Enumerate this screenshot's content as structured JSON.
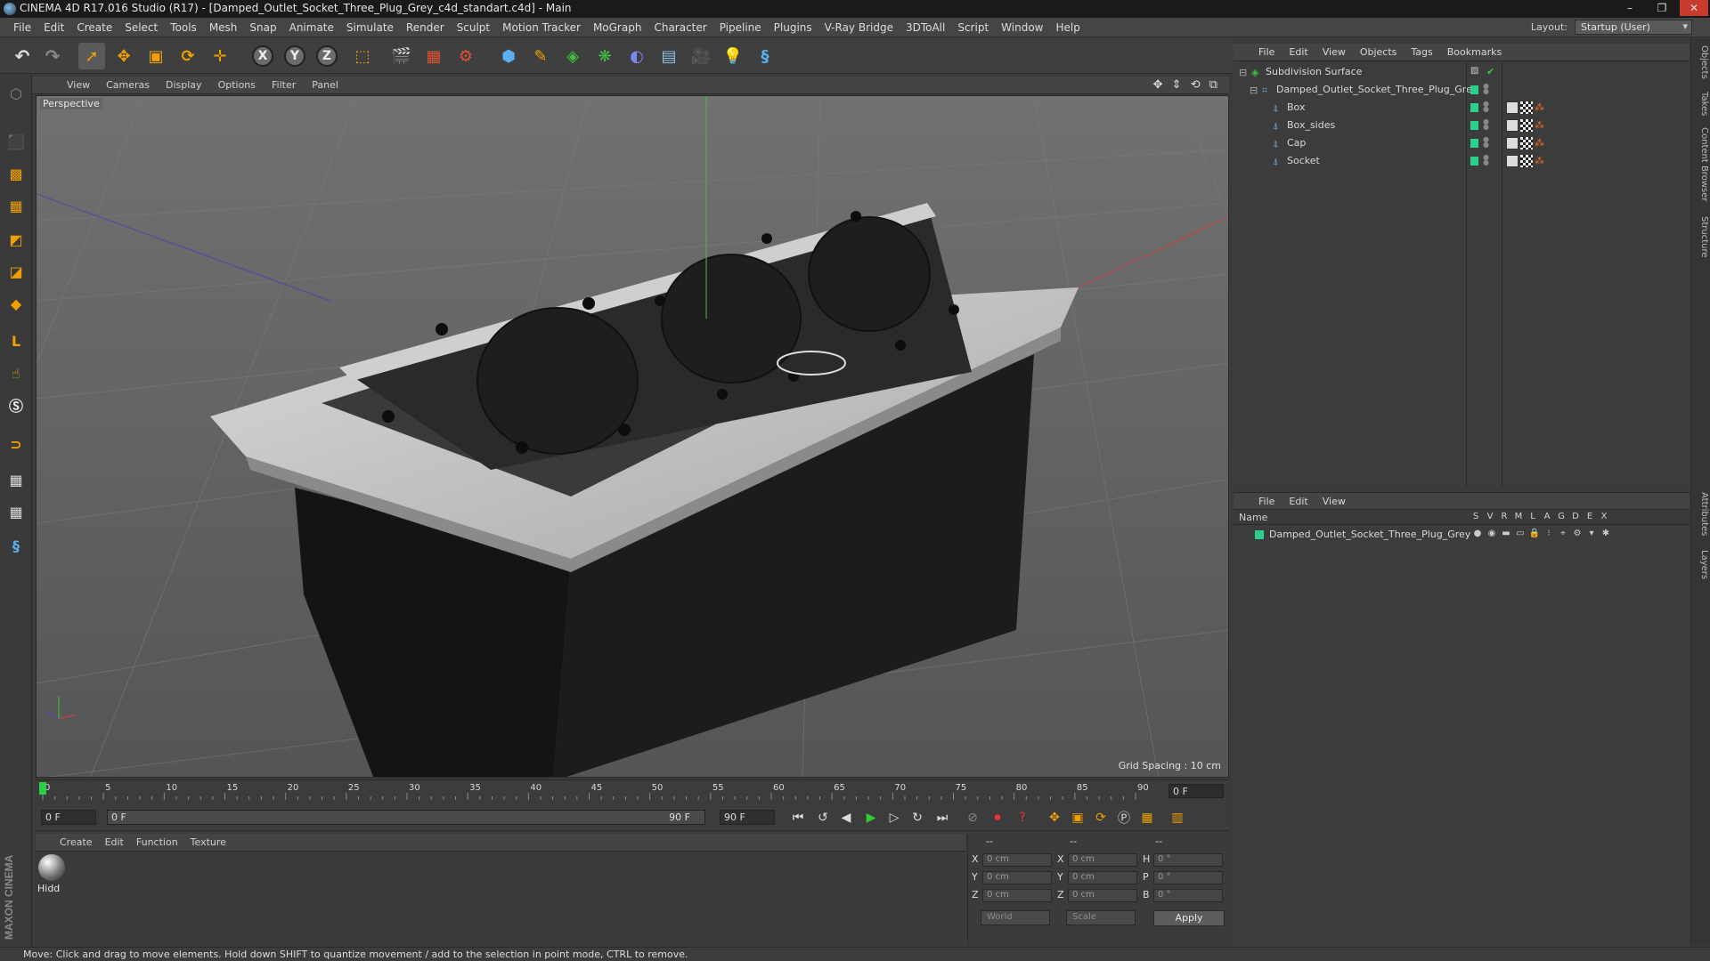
{
  "window": {
    "title": "CINEMA 4D R17.016 Studio (R17) - [Damped_Outlet_Socket_Three_Plug_Grey_c4d_standart.c4d] - Main",
    "controls": [
      "–",
      "❐",
      "✕"
    ]
  },
  "menubar": {
    "items": [
      "File",
      "Edit",
      "Create",
      "Select",
      "Tools",
      "Mesh",
      "Snap",
      "Animate",
      "Simulate",
      "Render",
      "Sculpt",
      "Motion Tracker",
      "MoGraph",
      "Character",
      "Pipeline",
      "Plugins",
      "V-Ray Bridge",
      "3DToAll",
      "Script",
      "Window",
      "Help"
    ],
    "layout_label": "Layout:",
    "layout_value": "Startup (User)"
  },
  "toolbar": {
    "axis_x": "X",
    "axis_y": "Y",
    "axis_z": "Z"
  },
  "viewport": {
    "menu": [
      "View",
      "Cameras",
      "Display",
      "Options",
      "Filter",
      "Panel"
    ],
    "label": "Perspective",
    "grid_spacing": "Grid Spacing : 10 cm",
    "nav_icons": "✥ ⇕ ⟲ ⧉"
  },
  "timeline": {
    "ticks": [
      "0",
      "5",
      "10",
      "15",
      "20",
      "25",
      "30",
      "35",
      "40",
      "45",
      "50",
      "55",
      "60",
      "65",
      "70",
      "75",
      "80",
      "85",
      "90"
    ],
    "current_frame": "0 F",
    "start_field": "0 F",
    "range_start": "0 F",
    "range_end": "90 F",
    "end_field": "90 F"
  },
  "material_manager": {
    "menu": [
      "Create",
      "Edit",
      "Function",
      "Texture"
    ],
    "material_name": "Hidd"
  },
  "coordinates": {
    "header": [
      "--",
      "--",
      "--"
    ],
    "rows": [
      {
        "l1": "X",
        "v1": "0 cm",
        "l2": "X",
        "v2": "0 cm",
        "l3": "H",
        "v3": "0 °"
      },
      {
        "l1": "Y",
        "v1": "0 cm",
        "l2": "Y",
        "v2": "0 cm",
        "l3": "P",
        "v3": "0 °"
      },
      {
        "l1": "Z",
        "v1": "0 cm",
        "l2": "Z",
        "v2": "0 cm",
        "l3": "B",
        "v3": "0 °"
      }
    ],
    "space_select": "World",
    "mode_select": "Scale",
    "apply_label": "Apply"
  },
  "object_manager": {
    "menu": [
      "File",
      "Edit",
      "View",
      "Objects",
      "Tags",
      "Bookmarks"
    ],
    "objects": [
      {
        "name": "Subdivision Surface",
        "level": 0
      },
      {
        "name": "Damped_Outlet_Socket_Three_Plug_Grey",
        "level": 1
      },
      {
        "name": "Box",
        "level": 2
      },
      {
        "name": "Box_sides",
        "level": 2
      },
      {
        "name": "Cap",
        "level": 2
      },
      {
        "name": "Socket",
        "level": 2
      }
    ]
  },
  "layer_manager": {
    "menu": [
      "File",
      "Edit",
      "View"
    ],
    "name_header": "Name",
    "columns": [
      "S",
      "V",
      "R",
      "M",
      "L",
      "A",
      "G",
      "D",
      "E",
      "X"
    ],
    "layers": [
      {
        "name": "Damped_Outlet_Socket_Three_Plug_Grey",
        "color": "#2bd08a"
      }
    ]
  },
  "right_tabs": [
    "Objects",
    "Takes",
    "Content Browser",
    "Structure",
    "Attributes",
    "Layers"
  ],
  "status": "Move: Click and drag to move elements. Hold down SHIFT to quantize movement / add to the selection in point mode, CTRL to remove.",
  "brand": "MAXON CINEMA 4D"
}
